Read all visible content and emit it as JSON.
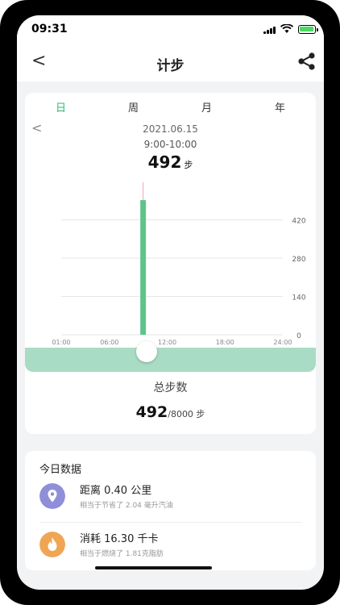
{
  "status": {
    "time": "09:31"
  },
  "nav": {
    "title": "计步",
    "back": "<"
  },
  "tabs": [
    {
      "label": "日",
      "active": true
    },
    {
      "label": "周",
      "active": false
    },
    {
      "label": "月",
      "active": false
    },
    {
      "label": "年",
      "active": false
    }
  ],
  "summary": {
    "prev": "<",
    "date": "2021.06.15",
    "range": "9:00-10:00",
    "steps": "492",
    "steps_unit": "步"
  },
  "chart_data": {
    "type": "bar",
    "x_ticks": [
      "01:00",
      "06:00",
      "12:00",
      "18:00",
      "24:00"
    ],
    "y_ticks": [
      "420",
      "280",
      "140",
      "0"
    ],
    "ylim": [
      0,
      560
    ],
    "values": [
      {
        "hour": 9,
        "steps": 492
      }
    ],
    "highlight_color": "#f3a3aa",
    "bar_color": "#5ec48b"
  },
  "total": {
    "label": "总步数",
    "value": "492",
    "goal": "/8000 步"
  },
  "today": {
    "title": "今日数据",
    "distance": {
      "main": "距离 0.40 公里",
      "sub": "相当于节省了 2.04 毫升汽油"
    },
    "calories": {
      "main": "消耗 16.30 千卡",
      "sub": "相当于燃烧了 1.81克脂肪"
    }
  },
  "colors": {
    "accent": "#2dbb6e",
    "bar": "#5ec48b",
    "slider": "#a9dcc5",
    "distance_icon": "#8e8fd8",
    "calorie_icon": "#f0a553"
  }
}
